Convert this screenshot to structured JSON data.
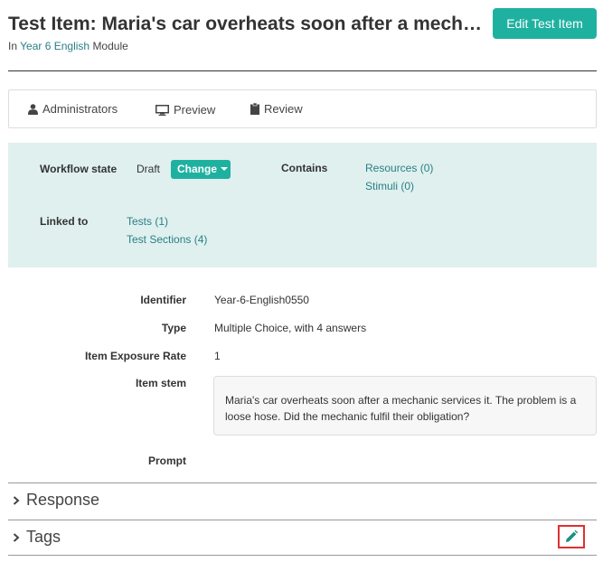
{
  "header": {
    "title": "Test Item: Maria's car overheats soon after a mechanic services it. The problem is a loose hose. Did the mechanic fulfil their obligation?",
    "subtitle_prefix": "In",
    "module_link": "Year 6 English",
    "subtitle_suffix": "Module",
    "edit_button": "Edit Test Item"
  },
  "tabs": [
    {
      "label": "Administrators",
      "icon": "user-icon"
    },
    {
      "label": "Preview",
      "icon": "monitor-icon"
    },
    {
      "label": "Review",
      "icon": "clipboard-icon"
    }
  ],
  "info": {
    "workflow_label": "Workflow state",
    "workflow_value": "Draft",
    "change_button": "Change",
    "contains_label": "Contains",
    "contains_links": [
      "Resources (0)",
      "Stimuli (0)"
    ],
    "linked_label": "Linked to",
    "linked_links": [
      "Tests (1)",
      "Test Sections (4)"
    ]
  },
  "details": {
    "identifier_label": "Identifier",
    "identifier_value": "Year-6-English0550",
    "type_label": "Type",
    "type_value": "Multiple Choice, with 4 answers",
    "exposure_label": "Item Exposure Rate",
    "exposure_value": "1",
    "stem_label": "Item stem",
    "stem_value": "Maria's car overheats soon after a mechanic services it. The problem is a loose hose. Did the mechanic fulfil their obligation?",
    "prompt_label": "Prompt"
  },
  "sections": {
    "response": "Response",
    "tags": "Tags"
  },
  "colors": {
    "accent": "#1fb1a0",
    "link": "#2a7f86",
    "panel_bg": "#dff0ee",
    "highlight": "#e03030"
  }
}
